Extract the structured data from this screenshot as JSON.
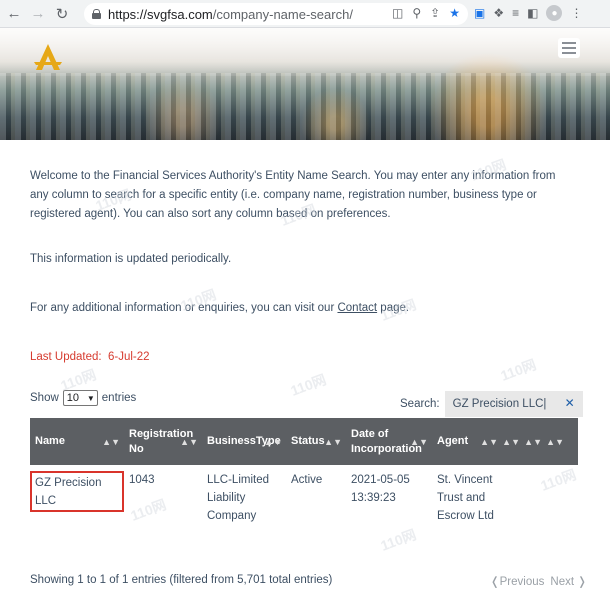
{
  "browser": {
    "url_domain": "https://svgfsa.com",
    "url_path": "/company-name-search/"
  },
  "intro": {
    "paragraph": "Welcome to the Financial Services Authority's Entity Name Search. You may enter any information from any column to search for a specific entity (i.e. company name, registration number, business type or registered agent). You can also sort any column based on preferences.",
    "updated_note": "This information is updated periodically.",
    "contact_prefix": "For any additional information or enquiries, you can visit our ",
    "contact_link": "Contact",
    "contact_suffix": " page.",
    "last_updated_label": "Last Updated:",
    "last_updated_value": "6-Jul-22"
  },
  "controls": {
    "show_label": "Show",
    "entries_value": "10",
    "entries_label": "entries",
    "search_label": "Search:",
    "search_value": "GZ Precision LLC"
  },
  "table": {
    "headers": [
      "Name",
      "Registration No",
      "BusinessType",
      "Status",
      "Date of Incorporation",
      "Agent",
      "",
      "",
      ""
    ],
    "rows": [
      {
        "name": "GZ Precision LLC",
        "registration_no": "1043",
        "business_type": "LLC-Limited Liability Company",
        "status": "Active",
        "date": "2021-05-05 13:39:23",
        "agent": "St. Vincent Trust and Escrow Ltd"
      }
    ]
  },
  "footer": {
    "info": "Showing 1 to 1 of 1 entries (filtered from 5,701 total entries)",
    "previous": "Previous",
    "next": "Next"
  },
  "watermark": "110网",
  "colors": {
    "header_bg": "#5c5f63",
    "highlight": "#d9342b",
    "last_updated": "#d63b2f"
  }
}
